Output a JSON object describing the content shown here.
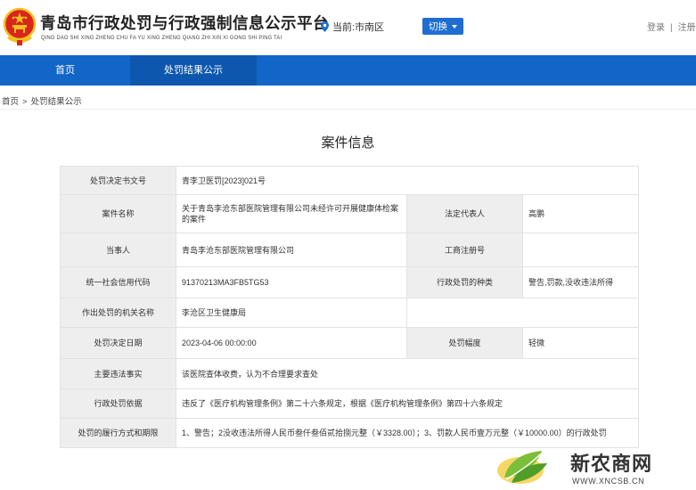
{
  "header": {
    "site_title": "青岛市行政处罚与行政强制信息公示平台",
    "site_subtitle": "QING DAO SHI XING ZHENG CHU FA YU XING ZHENG QIANG ZHI XIN XI GONG SHI PING TAI",
    "location": "当前:市南区",
    "switch_label": "切换",
    "login": "登录",
    "register": "注册",
    "auth_separator": "|"
  },
  "nav": {
    "items": [
      "首页",
      "处罚结果公示"
    ],
    "active": "处罚结果公示"
  },
  "breadcrumb": [
    "首页",
    "处罚结果公示"
  ],
  "breadcrumb_separator": ">",
  "page": {
    "title": "案件信息"
  },
  "case": {
    "doc_no_label": "处罚决定书文号",
    "doc_no": "青李卫医罚[2023]021号",
    "case_name_label": "案件名称",
    "case_name": "关于青岛李沧东部医院管理有限公司未经许可开展健康体检案的案件",
    "legal_rep_label": "法定代表人",
    "legal_rep": "高鹏",
    "party_label": "当事人",
    "party": "青岛李沧东部医院管理有限公司",
    "reg_no_label": "工商注册号",
    "reg_no": "",
    "credit_code_label": "统一社会信用代码",
    "credit_code": "91370213MA3FB5TG53",
    "penalty_type_label": "行政处罚的种类",
    "penalty_type": "警告,罚款,没收违法所得",
    "authority_label": "作出处罚的机关名称",
    "authority": "李沧区卫生健康局",
    "date_label": "处罚决定日期",
    "date": "2023-04-06 00:00:00",
    "range_label": "处罚幅度",
    "range": "轻微",
    "facts_label": "主要违法事实",
    "facts": "该医院查体收费，认为不合理要求查处",
    "basis_label": "行政处罚依据",
    "basis": "违反了《医疗机构管理条例》第二十六条规定，根据《医疗机构管理条例》第四十六条规定",
    "execution_label": "处罚的履行方式和期限",
    "execution": "1、警告；2没收违法所得人民币叁仟叁佰贰拾捌元整（￥3328.00）；3、罚款人民币壹万元整（￥10000.00）的行政处罚"
  },
  "watermark": {
    "brand": "新农商网",
    "url": "WWW.XNCSB.CN"
  },
  "icons": {
    "emblem": "national-emblem-icon",
    "location": "location-pin-icon",
    "dropdown": "caret-down-icon",
    "watermark_logo": "leaf-logo-icon"
  },
  "colors": {
    "nav_bg": "#1266c8",
    "nav_active": "#0e57ae",
    "button": "#1f6dd1",
    "label_bg": "#eeeeee",
    "emblem_red": "#d8261c",
    "emblem_gold": "#f2c01f"
  }
}
